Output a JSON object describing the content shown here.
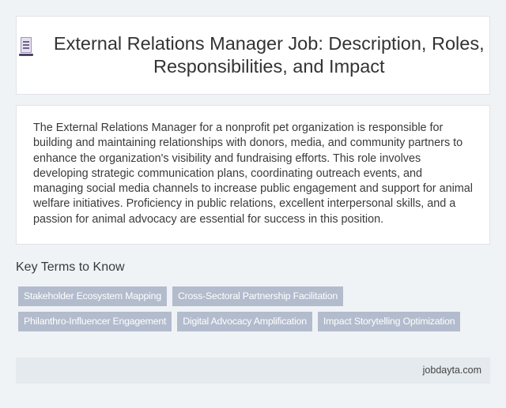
{
  "header": {
    "title": "External Relations Manager Job: Description, Roles, Responsibilities, and Impact",
    "icon": "document-icon"
  },
  "description": "The External Relations Manager for a nonprofit pet organization is responsible for building and maintaining relationships with donors, media, and community partners to enhance the organization's visibility and fundraising efforts. This role involves developing strategic communication plans, coordinating outreach events, and managing social media channels to increase public engagement and support for animal welfare initiatives. Proficiency in public relations, excellent interpersonal skills, and a passion for animal advocacy are essential for success in this position.",
  "key_terms": {
    "heading": "Key Terms to Know",
    "tags": [
      "Stakeholder Ecosystem Mapping",
      "Cross-Sectoral Partnership Facilitation",
      "Philanthro-Influencer Engagement",
      "Digital Advocacy Amplification",
      "Impact Storytelling Optimization"
    ]
  },
  "footer": {
    "source": "jobdayta.com"
  },
  "colors": {
    "background": "#f0f3f6",
    "tag_background": "#b3bccd",
    "footer_background": "#e4eaed"
  }
}
